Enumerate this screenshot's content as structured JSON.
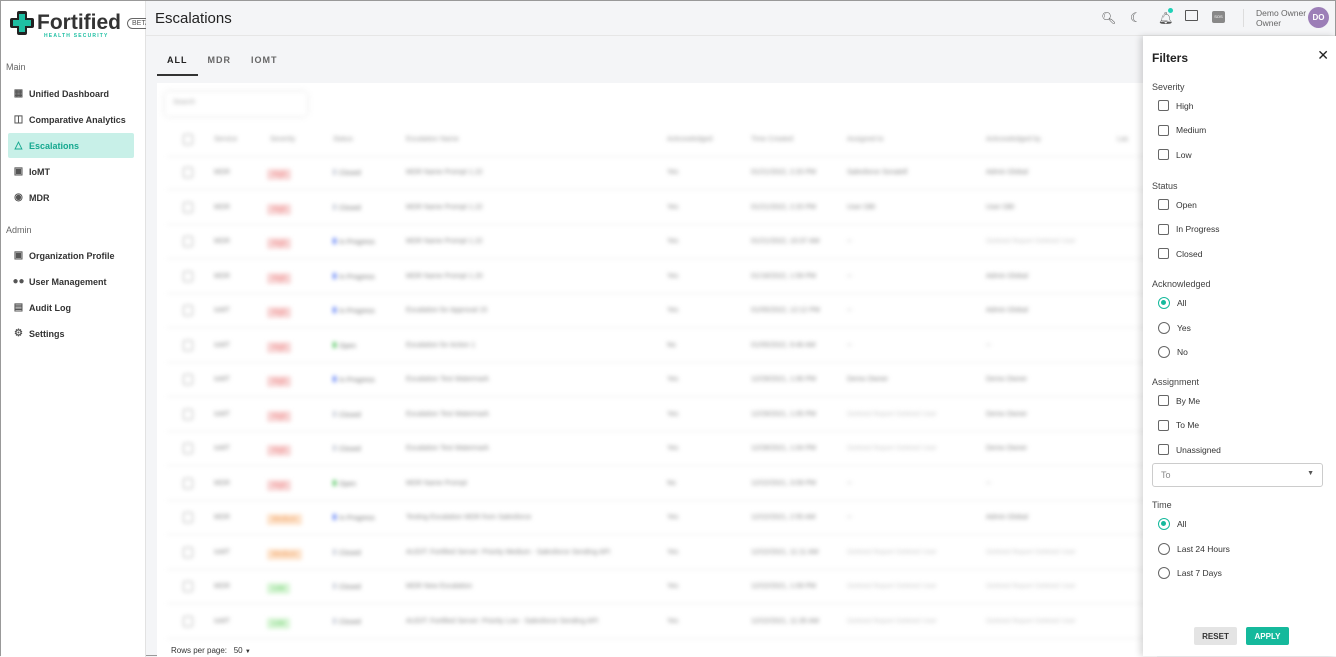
{
  "brand": {
    "name": "Fortified",
    "tagline": "HEALTH SECURITY",
    "badge": "BETA"
  },
  "sidebar": {
    "main_label": "Main",
    "admin_label": "Admin",
    "main_items": [
      {
        "label": "Unified Dashboard",
        "icon": "dashboard-icon"
      },
      {
        "label": "Comparative Analytics",
        "icon": "analytics-icon"
      },
      {
        "label": "Escalations",
        "icon": "warning-icon",
        "active": true
      },
      {
        "label": "IoMT",
        "icon": "devices-icon"
      },
      {
        "label": "MDR",
        "icon": "shield-icon"
      }
    ],
    "admin_items": [
      {
        "label": "Organization Profile",
        "icon": "briefcase-icon"
      },
      {
        "label": "User Management",
        "icon": "users-icon"
      },
      {
        "label": "Audit Log",
        "icon": "log-icon"
      },
      {
        "label": "Settings",
        "icon": "gear-icon"
      }
    ]
  },
  "header": {
    "title": "Escalations",
    "user_name": "Demo Owner",
    "user_role": "Owner",
    "avatar": "DO",
    "sos": "SOS"
  },
  "tabs": [
    "ALL",
    "MDR",
    "IOMT"
  ],
  "table": {
    "search_placeholder": "Search",
    "columns": [
      "Service",
      "Severity",
      "Status",
      "Escalation Name",
      "Acknowledged",
      "Time Created",
      "Assigned to",
      "Acknowledged by",
      "Las"
    ],
    "rows": [
      [
        "MDR",
        "High",
        "Closed",
        "MDR Name Prompt 1.22",
        "Yes",
        "01/21/2022, 2:20 PM",
        "Salesforce Sonatell",
        "Admin Global"
      ],
      [
        "MDR",
        "High",
        "Closed",
        "MDR Name Prompt 1.22",
        "Yes",
        "01/21/2022, 2:20 PM",
        "User DBI",
        "User DBI"
      ],
      [
        "MDR",
        "High",
        "In Progress",
        "MDR Name Prompt 1.22",
        "Yes",
        "01/21/2022, 10:37 AM",
        "--",
        "Deleted Report Deleted User"
      ],
      [
        "MDR",
        "High",
        "In Progress",
        "MDR Name Prompt 1.20",
        "Yes",
        "01/18/2022, 1:59 PM",
        "--",
        "Admin Global"
      ],
      [
        "IoMT",
        "High",
        "In Progress",
        "Escalation for Approval 15",
        "Yes",
        "01/05/2022, 12:12 PM",
        "--",
        "Admin Global"
      ],
      [
        "IoMT",
        "High",
        "Open",
        "Escalation for Action 1",
        "No",
        "01/05/2022, 9:46 AM",
        "--",
        "--"
      ],
      [
        "IoMT",
        "High",
        "In Progress",
        "Escalation Test Watermark",
        "Yes",
        "12/29/2021, 1:06 PM",
        "Demo Owner",
        "Demo Owner"
      ],
      [
        "IoMT",
        "High",
        "Closed",
        "Escalation Test Watermark",
        "Yes",
        "12/29/2021, 1:05 PM",
        "Deleted Report Deleted User",
        "Demo Owner"
      ],
      [
        "IoMT",
        "High",
        "Closed",
        "Escalation Test Watermark",
        "Yes",
        "12/28/2021, 1:04 PM",
        "Deleted Report Deleted User",
        "Demo Owner"
      ],
      [
        "MDR",
        "High",
        "Open",
        "MDR Name Prompt",
        "No",
        "12/22/2021, 3:09 PM",
        "--",
        "--"
      ],
      [
        "MDR",
        "Medium",
        "In Progress",
        "Testing Escalation MDR from Salesforce",
        "Yes",
        "12/22/2021, 2:55 AM",
        "--",
        "Admin Global"
      ],
      [
        "IoMT",
        "Medium",
        "Closed",
        "AUDIT: Fortified Server: Priority Medium - Salesforce Sending API",
        "Yes",
        "12/22/2021, 11:11 AM",
        "Deleted Report Deleted User",
        "Deleted Report Deleted User"
      ],
      [
        "MDR",
        "Low",
        "Closed",
        "MDR New Escalation",
        "Yes",
        "12/22/2021, 1:09 PM",
        "Deleted Report Deleted User",
        "Deleted Report Deleted User"
      ],
      [
        "IoMT",
        "Low",
        "Closed",
        "AUDIT: Fortified Server: Priority Low - Salesforce Sending API",
        "Yes",
        "12/22/2021, 11:35 AM",
        "Deleted Report Deleted User",
        "Deleted Report Deleted User"
      ]
    ]
  },
  "footer": {
    "rows_label": "Rows per page:",
    "rows_value": "50"
  },
  "filters": {
    "title": "Filters",
    "severity": {
      "label": "Severity",
      "options": [
        "High",
        "Medium",
        "Low"
      ]
    },
    "status": {
      "label": "Status",
      "options": [
        "Open",
        "In Progress",
        "Closed"
      ]
    },
    "acknowledged": {
      "label": "Acknowledged",
      "options": [
        "All",
        "Yes",
        "No"
      ],
      "selected": "All"
    },
    "assignment": {
      "label": "Assignment",
      "options": [
        "By Me",
        "To Me",
        "Unassigned"
      ],
      "to_placeholder": "To"
    },
    "time": {
      "label": "Time",
      "options": [
        "All",
        "Last 24 Hours",
        "Last 7 Days"
      ],
      "selected": "All"
    },
    "reset": "RESET",
    "apply": "APPLY"
  },
  "colors": {
    "accent": "#15b99c",
    "high": "#f8d7d7",
    "medium": "#fde3cc",
    "low": "#d8f5d6",
    "in_progress": "#5b7cf5",
    "open": "#4cc35a",
    "closed": "#c6cbd6"
  }
}
